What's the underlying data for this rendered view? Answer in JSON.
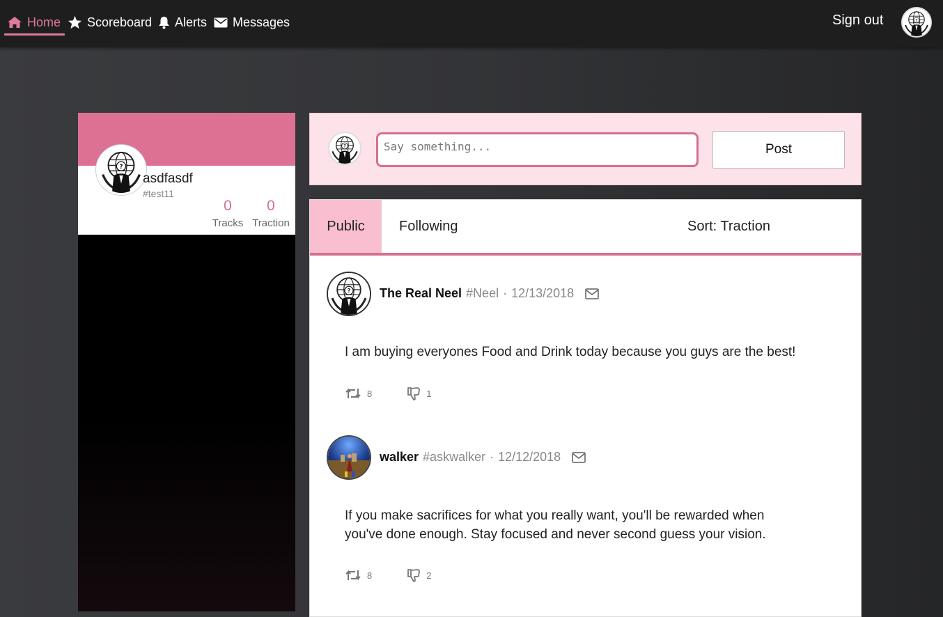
{
  "nav": {
    "items": [
      {
        "label": "Home",
        "icon": "home-icon",
        "active": true
      },
      {
        "label": "Scoreboard",
        "icon": "star-icon"
      },
      {
        "label": "Alerts",
        "icon": "bell-icon"
      },
      {
        "label": "Messages",
        "icon": "envelope-icon"
      }
    ],
    "sign_out": "Sign out",
    "accent": "#e07a99"
  },
  "profile": {
    "name": "asdfasdf",
    "handle": "#test11",
    "tracks_value": "0",
    "tracks_label": "Tracks",
    "traction_value": "0",
    "traction_label": "Traction",
    "banner_color": "#dc7193"
  },
  "compose": {
    "placeholder": "Say something...",
    "value": "",
    "post_label": "Post"
  },
  "feed": {
    "tabs": [
      {
        "label": "Public",
        "active": true
      },
      {
        "label": "Following"
      }
    ],
    "sort_label": "Sort: Traction",
    "posts": [
      {
        "author": "The Real Neel",
        "handle": "#Neel",
        "separator": "·",
        "date": "12/13/2018",
        "text": "I am buying everyones Food and Drink today because you guys are the best!",
        "retweets": "8",
        "dislikes": "1"
      },
      {
        "author": "walker",
        "handle": "#askwalker",
        "separator": "·",
        "date": "12/12/2018",
        "text": "If you make sacrifices for what you really want, you'll be rewarded when you've done enough. Stay focused and never second guess your vision.",
        "retweets": "8",
        "dislikes": "2"
      }
    ]
  }
}
